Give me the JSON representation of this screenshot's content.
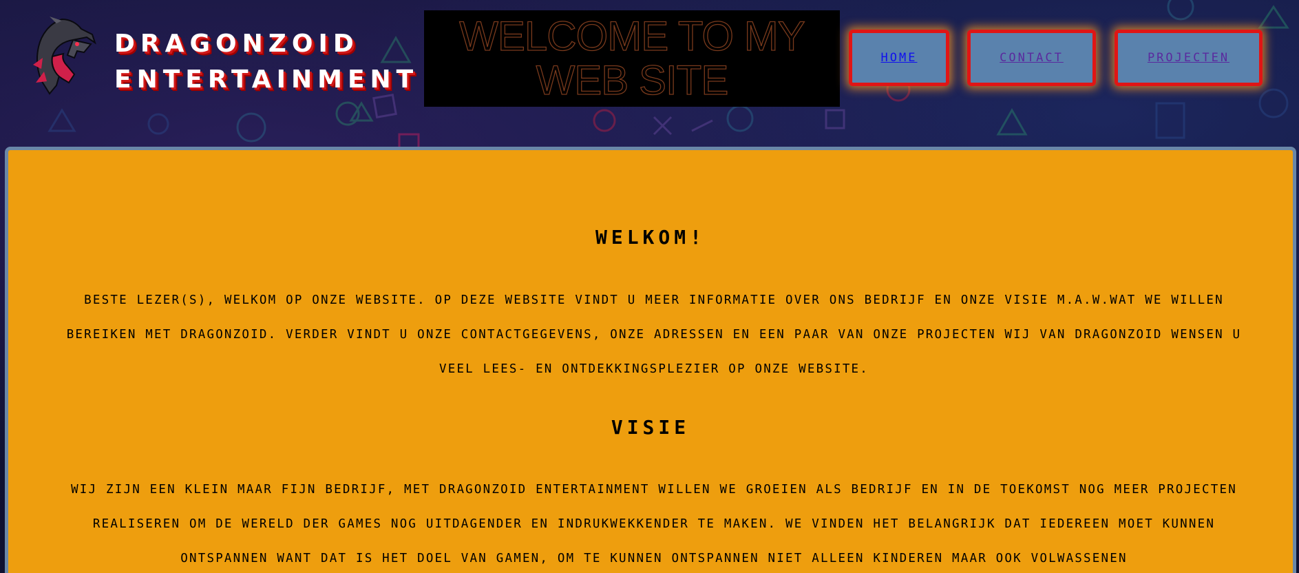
{
  "header": {
    "brand_line1": "DRAGONZOID",
    "brand_line2": "ENTERTAINMENT",
    "logo_icon": "dragon-head-icon",
    "welcome_line1": "WELCOME TO MY",
    "welcome_line2": "WEB SITE"
  },
  "nav": {
    "home": "HOME",
    "contact": "CONTACT",
    "projecten": "PROJECTEN"
  },
  "main": {
    "welkom_title": "WELKOM!",
    "welkom_text": "BESTE LEZER(S), WELKOM OP ONZE WEBSITE. OP DEZE WEBSITE VINDT U MEER INFORMATIE OVER ONS BEDRIJF EN ONZE VISIE M.A.W.WAT WE WILLEN BEREIKEN MET DRAGONZOID. VERDER VINDT U ONZE CONTACTGEGEVENS, ONZE ADRESSEN EN EEN PAAR VAN ONZE PROJECTEN WIJ VAN DRAGONZOID WENSEN U VEEL LEES- EN ONTDEKKINGSPLEZIER OP ONZE WEBSITE.",
    "visie_title": "VISIE",
    "visie_text": "WIJ ZIJN EEN KLEIN MAAR FIJN BEDRIJF, MET DRAGONZOID ENTERTAINMENT WILLEN WE GROEIEN ALS BEDRIJF EN IN DE TOEKOMST NOG MEER PROJECTEN REALISEREN OM DE WERELD DER GAMES NOG UITDAGENDER EN INDRUKWEKKENDER TE MAKEN. WE VINDEN HET BELANGRIJK DAT IEDEREEN MOET KUNNEN ONTSPANNEN WANT DAT IS HET DOEL VAN GAMEN, OM TE KUNNEN ONTSPANNEN NIET ALLEEN KINDEREN MAAR OOK VOLWASSENEN"
  },
  "colors": {
    "panel": "#ee9e0e",
    "panel_border": "#6a87a8",
    "nav_bg": "#5a82ad",
    "nav_border": "#e01515",
    "home_link": "#1010ee",
    "visited_link": "#5a2a9e",
    "page_bg": "#0c0f2e"
  }
}
